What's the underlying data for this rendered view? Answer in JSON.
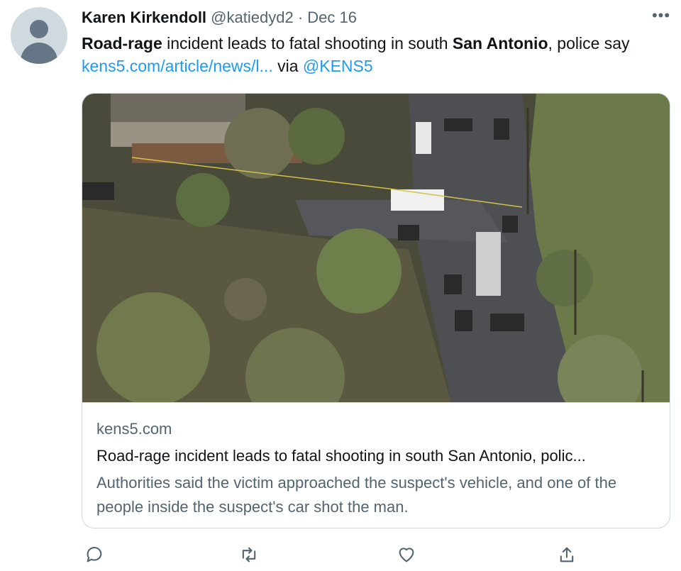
{
  "tweet": {
    "author_name": "Karen Kirkendoll",
    "author_handle": "@katiedyd2",
    "separator": "·",
    "date": "Dec 16",
    "more_label": "•••",
    "text_part1": "Road-rage",
    "text_part2": " incident leads to fatal shooting in south ",
    "text_part3": "San Antonio",
    "text_part4": ", police say",
    "link_text": "kens5.com/article/news/l...",
    "via_text": " via ",
    "mention": "@KENS5"
  },
  "card": {
    "domain": "kens5.com",
    "title": "Road-rage incident leads to fatal shooting in south San Antonio, polic...",
    "description": "Authorities said the victim approached the suspect's vehicle, and one of the people inside the suspect's car shot the man."
  },
  "actions": {
    "reply_icon": "reply-icon",
    "retweet_icon": "retweet-icon",
    "like_icon": "heart-icon",
    "share_icon": "share-icon"
  },
  "colors": {
    "link": "#1d9bf0",
    "muted": "#536471",
    "border": "#cfd9de"
  }
}
